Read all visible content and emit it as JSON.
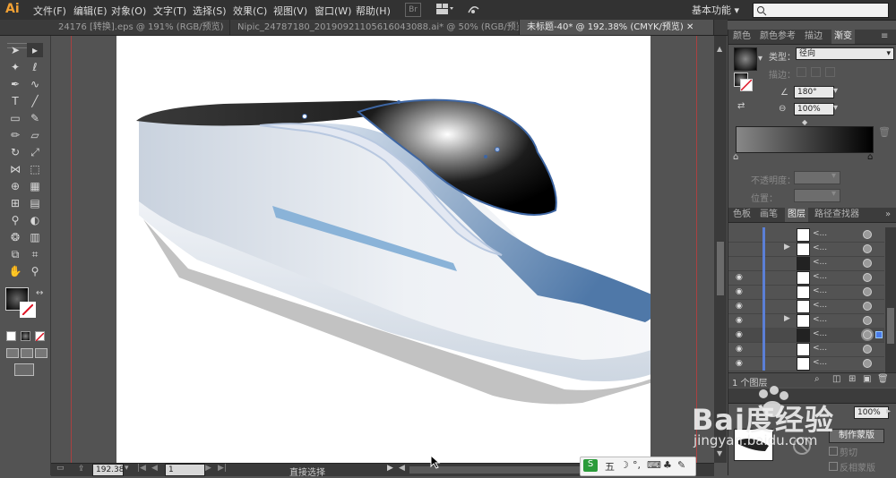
{
  "app": {
    "logo": "Ai",
    "menus": [
      "文件(F)",
      "编辑(E)",
      "对象(O)",
      "文字(T)",
      "选择(S)",
      "效果(C)",
      "视图(V)",
      "窗口(W)",
      "帮助(H)"
    ],
    "br_label": "Br",
    "workspace": "基本功能",
    "search_placeholder": ""
  },
  "tabs": [
    {
      "label": "24176 [转换].eps @ 191% (RGB/预览)",
      "active": false
    },
    {
      "label": "Nipic_24787180_20190921105616043088.ai* @ 50% (RGB/预览)",
      "active": false
    },
    {
      "label": "未标题-40* @ 192.38% (CMYK/预览)",
      "active": true
    }
  ],
  "tools": [
    "selection-tool",
    "direct-selection-tool",
    "magic-wand-tool",
    "lasso-tool",
    "pen-tool",
    "curvature-tool",
    "type-tool",
    "line-tool",
    "rectangle-tool",
    "paintbrush-tool",
    "pencil-tool",
    "eraser-tool",
    "rotate-tool",
    "scale-tool",
    "width-tool",
    "free-transform-tool",
    "shape-builder-tool",
    "perspective-tool",
    "mesh-tool",
    "gradient-tool",
    "eyedropper-tool",
    "blend-tool",
    "symbol-sprayer-tool",
    "column-graph-tool",
    "artboard-tool",
    "slice-tool",
    "hand-tool",
    "zoom-tool"
  ],
  "colors": {
    "accent": "#f2a134",
    "guide": "#a94040",
    "layer_bar": "#5b7fd6",
    "train_blue": "#8ab3d8",
    "train_dark": "#1a1a1a"
  },
  "status": {
    "zoom": "192.38",
    "page": "1",
    "mode": "直接选择"
  },
  "gradient_panel": {
    "tabs": [
      "颜色",
      "颜色参考",
      "描边",
      "渐变"
    ],
    "type_label": "类型：",
    "type_value": "径向",
    "stroke_label": "描边：",
    "angle_value": "180°",
    "aspect_value": "100%",
    "opacity_label": "不透明度：",
    "location_label": "位置："
  },
  "layers_panel": {
    "tabs": [
      "色板",
      "画笔",
      "图层",
      "路径查找器"
    ],
    "rows": [
      {
        "name": "<...",
        "visible": false,
        "expand": false
      },
      {
        "name": "<...",
        "visible": false,
        "expand": true
      },
      {
        "name": "<...",
        "visible": false,
        "expand": false
      },
      {
        "name": "<...",
        "visible": true,
        "expand": false
      },
      {
        "name": "<...",
        "visible": true,
        "expand": false
      },
      {
        "name": "<...",
        "visible": true,
        "expand": false
      },
      {
        "name": "<...",
        "visible": true,
        "expand": true
      },
      {
        "name": "<...",
        "visible": true,
        "expand": false
      },
      {
        "name": "<...",
        "visible": true,
        "expand": false
      },
      {
        "name": "<...",
        "visible": true,
        "expand": false
      }
    ],
    "footer": "1 个图层"
  },
  "bottom_panel": {
    "percent": "100%",
    "make_mask": "制作蒙版",
    "clip": "剪切",
    "invert_mask": "反相蒙版"
  },
  "ime": {
    "label": "五"
  },
  "watermark": {
    "brand": "Bai度经验",
    "url": "jingyan.baidu.com"
  }
}
